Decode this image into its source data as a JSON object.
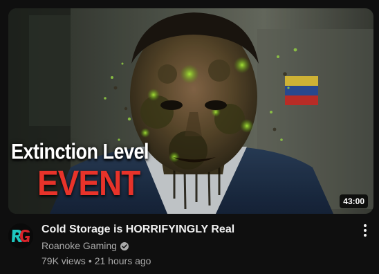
{
  "video": {
    "thumbnail_text_line1": "Extinction Level",
    "thumbnail_text_line2": "EVENT",
    "duration": "43:00",
    "title": "Cold Storage is HORRIFYINGLY Real",
    "channel": "Roanoke Gaming",
    "views": "79K views",
    "separator": "•",
    "age": "21 hours ago"
  },
  "icons": {
    "verified": "verified-check-icon",
    "menu": "more-vert-icon",
    "avatar_logo": "rg-logo"
  },
  "colors": {
    "background": "#0f0f0f",
    "title_text": "#f1f1f1",
    "secondary_text": "#aaaaaa",
    "event_red": "#e8332a",
    "logo_teal": "#1ec7c0",
    "logo_red": "#d8232a"
  }
}
